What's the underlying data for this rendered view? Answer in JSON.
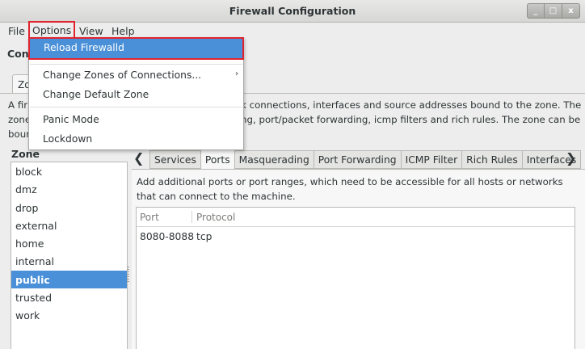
{
  "window": {
    "title": "Firewall Configuration",
    "buttons": [
      "_",
      "□",
      "x"
    ]
  },
  "menubar": [
    "File",
    "Options",
    "View",
    "Help"
  ],
  "header": {
    "title": "Conf"
  },
  "top_tab": {
    "label": "Zo"
  },
  "description": {
    "line1_left": "A fir",
    "line1_right": "k connections, interfaces and source addresses bound to the zone. The",
    "line2_left": "zone",
    "line2_right": "ng, port/packet forwarding, icmp filters and rich rules. The zone can be",
    "line3_left": "bour"
  },
  "zones": {
    "label": "Zone",
    "items": [
      "block",
      "dmz",
      "drop",
      "external",
      "home",
      "internal",
      "public",
      "trusted",
      "work"
    ],
    "selected": "public"
  },
  "subtabs": {
    "left_arrow": "❮",
    "right_arrow": "❯",
    "items": [
      "Services",
      "Ports",
      "Masquerading",
      "Port Forwarding",
      "ICMP Filter",
      "Rich Rules",
      "Interfaces"
    ],
    "active": "Ports"
  },
  "ports": {
    "description": "Add additional ports or port ranges, which need to be accessible for all hosts or networks that can connect to the machine.",
    "columns": [
      "Port",
      "Protocol"
    ],
    "rows": [
      {
        "port": "8080-8088",
        "protocol": "tcp"
      }
    ]
  },
  "options_menu": {
    "items": [
      "Reload Firewalld",
      "Change Zones of Connections...",
      "Change Default Zone",
      "Panic Mode",
      "Lockdown"
    ],
    "highlighted": "Reload Firewalld",
    "submenu_arrow": "›"
  },
  "colors": {
    "selection": "#4a90d9",
    "highlight_outline": "#e0242f"
  }
}
